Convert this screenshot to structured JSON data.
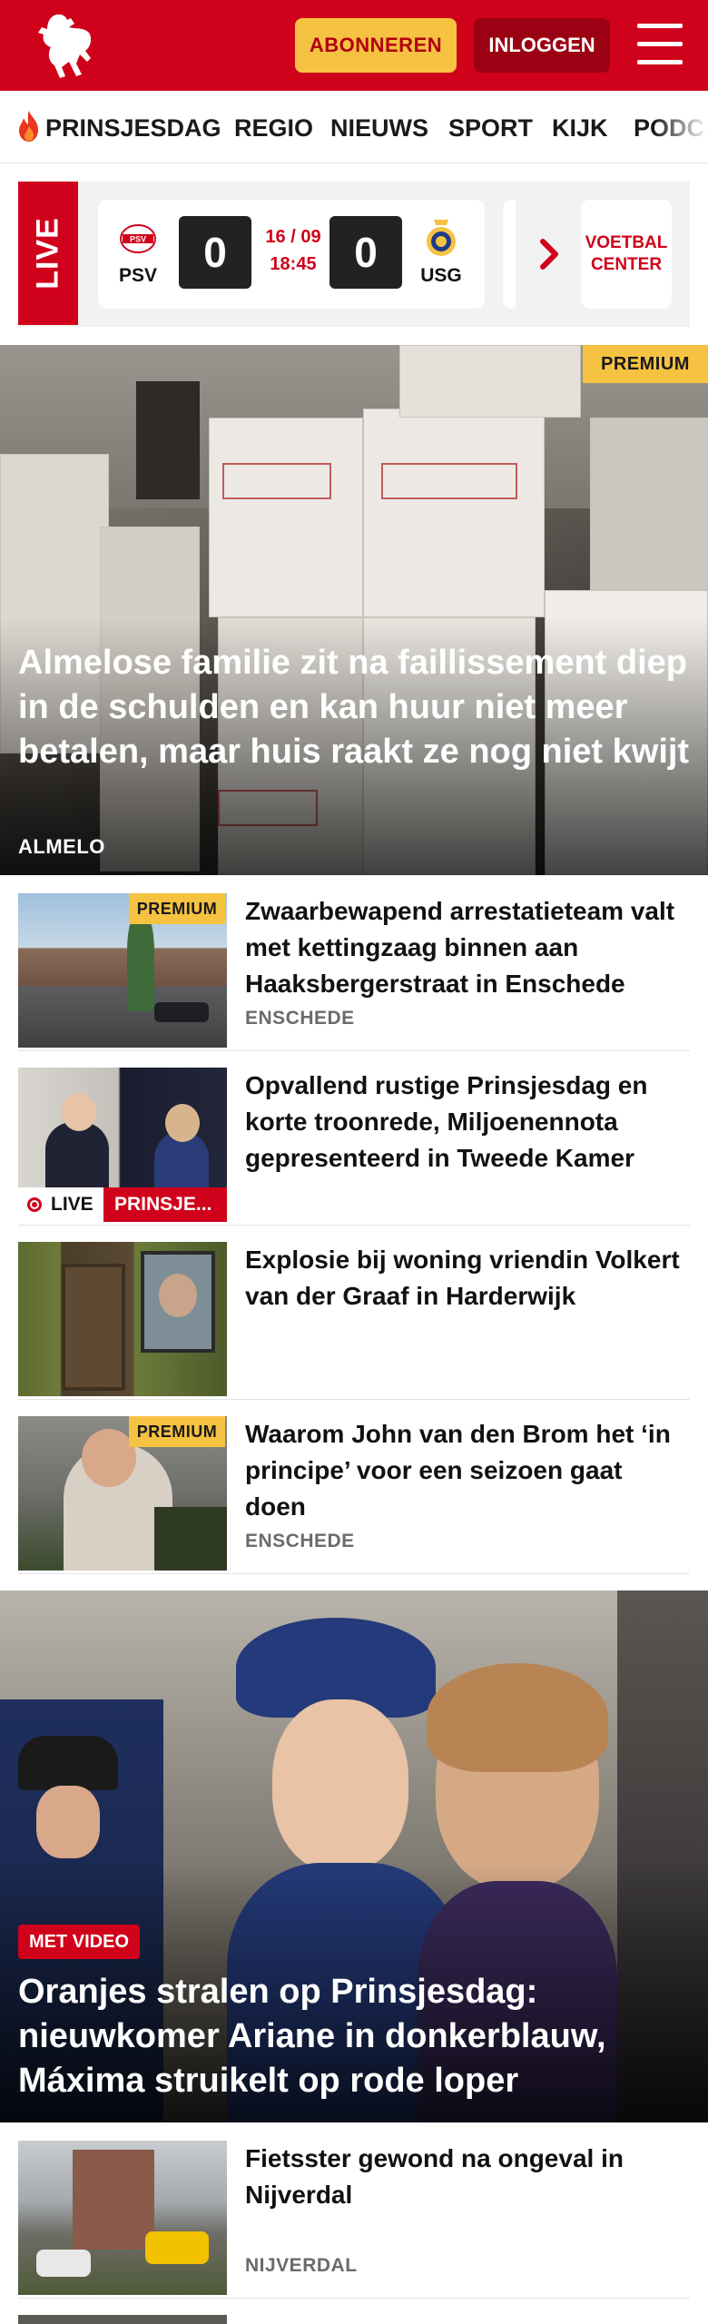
{
  "header": {
    "subscribe_label": "ABONNEREN",
    "login_label": "INLOGGEN",
    "brand_color": "#d0021b",
    "accent_color": "#f5c242"
  },
  "nav": {
    "items": [
      {
        "label": "PRINSJESDAG",
        "icon": "flame-icon"
      },
      {
        "label": "REGIO"
      },
      {
        "label": "NIEUWS"
      },
      {
        "label": "SPORT"
      },
      {
        "label": "KIJK"
      },
      {
        "label": "PODCA"
      }
    ]
  },
  "live": {
    "badge": "LIVE",
    "match": {
      "home_team": "PSV",
      "home_score": "0",
      "away_team": "USG",
      "away_score": "0",
      "date": "16 / 09",
      "time": "18:45"
    },
    "voetbal_center_line1": "VOETBAL",
    "voetbal_center_line2": "CENTER"
  },
  "hero": {
    "premium": "PREMIUM",
    "title": "Almelose familie zit na faillissement diep in de schulden en kan huur niet meer betalen, maar huis raakt ze nog niet kwijt",
    "location": "ALMELO"
  },
  "articles": [
    {
      "premium": "PREMIUM",
      "title": "Zwaarbewapend arrestatieteam valt met kettingzaag binnen aan Haaksbergerstraat in Enschede",
      "location": "ENSCHEDE"
    },
    {
      "live": "LIVE",
      "category": "PRINSJE...",
      "title": "Opvallend rustige Prinsjesdag en korte troonrede, Miljoenennota gepresenteerd in Tweede Kamer"
    },
    {
      "title": "Explosie bij woning vriendin Volkert van der Graaf in Harderwijk"
    },
    {
      "premium": "PREMIUM",
      "title": "Waarom John van den Brom het ‘in principe’ voor een seizoen gaat doen",
      "location": "ENSCHEDE"
    }
  ],
  "hero2": {
    "video_tag": "MET VIDEO",
    "title": "Oranjes stralen op Prinsjesdag: nieuwkomer Ariane in donkerblauw, Máxima struikelt op rode loper"
  },
  "articles2": [
    {
      "title": "Fietsster gewond na ongeval in Nijverdal",
      "location": "NIJVERDAL"
    }
  ]
}
